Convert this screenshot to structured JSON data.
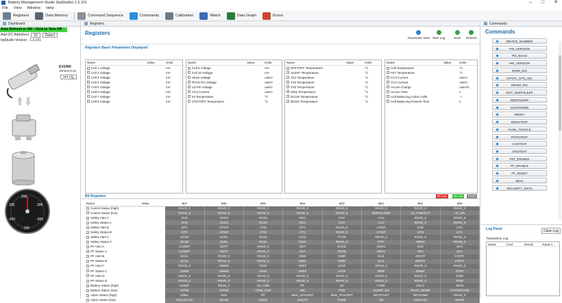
{
  "app": {
    "title": "Battery Management Studio (bqStudio) 1.3.101"
  },
  "window_controls": [
    "–",
    "□",
    "✕"
  ],
  "menu": [
    "File",
    "View",
    "Window",
    "Help"
  ],
  "toolbar": [
    {
      "label": "Registers",
      "icon": "gear-icon",
      "color": "#6b7f95"
    },
    {
      "label": "Data Memory",
      "icon": "car-icon",
      "color": "#5a6470"
    },
    {
      "label": "Command Sequence",
      "icon": "abc-icon",
      "color": "#8a9099"
    },
    {
      "label": "Commands",
      "icon": "refresh-arrows-icon",
      "color": "#2a8fd8"
    },
    {
      "label": "Calibration",
      "icon": "screen-icon",
      "color": "#6a7a8a"
    },
    {
      "label": "Watch",
      "icon": "watch-icon",
      "color": "#3a6ab8"
    },
    {
      "label": "Data Graph",
      "icon": "graph-icon",
      "color": "#2a7a3a"
    },
    {
      "label": "Errors",
      "icon": "errors-icon",
      "color": "#c74a2a"
    }
  ],
  "dashboard": {
    "title": "Dashboard",
    "auto_refresh": "Auto Refresh is ON - Click to Turn Off",
    "i2c_label": "Add I2C Addr(hex)",
    "i2c_value": "16",
    "detect_label": "Detect",
    "version_label": "bqStudio Version:",
    "version_value": "1.3.101",
    "device": "EV2400",
    "device_version": "Version:0.32",
    "spi_cfg": "SPI Cfg",
    "gauge_labels": [
      "200",
      "100",
      "300",
      "-200",
      "-300",
      "-100"
    ]
  },
  "registers": {
    "tab": "Registers",
    "title": "Registers",
    "subtitle": "Registers    Basic Parameters Displayed",
    "tools": [
      "Parameter View",
      "Start Log",
      "Scan",
      "Refresh"
    ],
    "columns": [
      "Name",
      "Value",
      "Units"
    ],
    "groups": [
      {
        "rows": [
          [
            "Cell 1 Voltage",
            "",
            "mV"
          ],
          [
            "Cell 2 Voltage",
            "",
            "mV"
          ],
          [
            "Cell 3 Voltage",
            "",
            "mV"
          ],
          [
            "Cell 4 Voltage",
            "",
            "mV"
          ],
          [
            "Cell 5 Voltage",
            "",
            "mV"
          ],
          [
            "Cell 6 Voltage",
            "",
            "mV"
          ],
          [
            "Cell 7 Voltage",
            "",
            "mV"
          ],
          [
            "Cell 8 Voltage",
            "",
            "mV"
          ]
        ]
      },
      {
        "rows": [
          [
            "Cell 9 Voltage",
            "",
            "mV"
          ],
          [
            "Cell 10 Voltage",
            "",
            "mV"
          ],
          [
            "Stack Voltage",
            "",
            "userV"
          ],
          [
            "PACK Pin Voltage",
            "",
            "userV"
          ],
          [
            "LD Pin Voltage",
            "",
            "userV"
          ],
          [
            "CC2 Current",
            "",
            "userA"
          ],
          [
            "Int Temperature",
            "",
            "°C"
          ],
          [
            "CFETOFF Temperature",
            "",
            "°C"
          ]
        ]
      },
      {
        "rows": [
          [
            "DFETOFF Temperature",
            "",
            "°C"
          ],
          [
            "ALERT Temperature",
            "",
            "°C"
          ],
          [
            "TS1 Temperature",
            "",
            "°C"
          ],
          [
            "TS2 Temperature",
            "",
            "°C"
          ],
          [
            "TS3 Temperature",
            "",
            "°C"
          ],
          [
            "HDQ Temperature",
            "",
            "°C"
          ],
          [
            "DCHG Temperature",
            "",
            "°C"
          ],
          [
            "DDSG Temperature",
            "",
            "°C"
          ]
        ]
      },
      {
        "rows": [
          [
            "Cell Temperature",
            "",
            "°C"
          ],
          [
            "FET Temperature",
            "",
            "°C"
          ],
          [
            "CC3 Current",
            "",
            "userA"
          ],
          [
            "CC1 Current",
            "",
            "userA"
          ],
          [
            "Accum Charge",
            "",
            "userAh"
          ],
          [
            "Accum Time",
            "",
            "s"
          ],
          [
            "Cell Balancing Active Cells",
            "",
            "—"
          ],
          [
            "Cell Balancing Present Time",
            "",
            "s"
          ]
        ]
      }
    ]
  },
  "bit_registers": {
    "title": "Bit Registers",
    "legend": [
      {
        "label": "Bit High",
        "color": "#e03030"
      },
      {
        "label": "Bit Low",
        "color": "#3fbf3f"
      },
      {
        "label": "RSVD",
        "color": "#888888"
      }
    ],
    "columns": [
      "Name",
      "Value",
      "Bit7",
      "Bit6",
      "Bit5",
      "Bit4",
      "Bit3",
      "Bit2",
      "Bit1",
      "Bit0"
    ],
    "rows": [
      {
        "name": "Control Status (high)",
        "bits": [
          "RSVD_0",
          "RSVD_0",
          "RSVD_0",
          "RSVD_0",
          "RSVD_0",
          "RSVD_0",
          "RSVD_0",
          "RSVD_0"
        ]
      },
      {
        "name": "Control Status (low)",
        "bits": [
          "RSVD_0",
          "RSVD_0",
          "RSVD_0",
          "RSVD_0",
          "RSVD_0",
          "DEEPSLEEP",
          "LD_TIMEOUT",
          "LD_ON"
        ]
      },
      {
        "name": "Safety Alert A",
        "bits": [
          "SCD",
          "OCD2",
          "OCD1",
          "OCC",
          "COV",
          "CUV",
          "RSVD_0",
          "RSVD_0"
        ]
      },
      {
        "name": "Safety Status A",
        "bits": [
          "SCD",
          "OCD2",
          "OCD1",
          "OCC",
          "COV",
          "CUV",
          "RSVD_0",
          "RSVD_0"
        ]
      },
      {
        "name": "Safety Alert B",
        "bits": [
          "OTF",
          "OTINT",
          "OTD",
          "OTC",
          "RSVD_0",
          "UTINT",
          "UTD",
          "UTC"
        ]
      },
      {
        "name": "Safety Status B",
        "bits": [
          "OTF",
          "OTINT",
          "OTD",
          "OTC",
          "RSVD_0",
          "UTINT",
          "UTD",
          "UTC"
        ]
      },
      {
        "name": "Safety Alert C",
        "bits": [
          "OCD3",
          "SCDL",
          "OCDL",
          "COVL",
          "PTOS",
          "RSVD_0",
          "RSVD_0",
          "RSVD_0"
        ]
      },
      {
        "name": "Safety Status C",
        "bits": [
          "OCD3",
          "SCDL",
          "OCDL",
          "COVL",
          "RSVD_0",
          "PTO",
          "HWDF",
          "RSVD_0"
        ]
      },
      {
        "name": "PF Alert A",
        "bits": [
          "CUDEP",
          "SOTF",
          "RSVD_0",
          "SOT",
          "SOCD",
          "SOCC",
          "SOV",
          "SUV"
        ]
      },
      {
        "name": "PF Status A",
        "bits": [
          "CUDEP",
          "SOTF",
          "RSVD_0",
          "SOT",
          "SOCD",
          "SOCC",
          "SOV",
          "SUV"
        ]
      },
      {
        "name": "PF Alert B",
        "bits": [
          "SCDL",
          "RSVD_0",
          "RSVD_0",
          "VIMA",
          "VIMR",
          "2LVL",
          "DFETF",
          "CFETF"
        ]
      },
      {
        "name": "PF Status B",
        "bits": [
          "SCDL",
          "RSVD_0",
          "RSVD_0",
          "VIMA",
          "VIMR",
          "2LVL",
          "DFETF",
          "CFETF"
        ]
      },
      {
        "name": "PF Alert C",
        "bits": [
          "RSVD_0",
          "HWMX",
          "VSSF",
          "VREF",
          "LFOF",
          "RSVD_0",
          "RSVD_0",
          "RSVD_0"
        ]
      },
      {
        "name": "PF Status C",
        "bits": [
          "CMDF",
          "HWMX",
          "VSSF",
          "VREF",
          "LFOF",
          "IRMF",
          "DRMF",
          "OTPF"
        ]
      },
      {
        "name": "PF Alert D",
        "bits": [
          "RSVD_0",
          "RSVD_0",
          "RSVD_0",
          "RSVD_0",
          "RSVD_0",
          "RSVD_0",
          "RSVD_0",
          "TOSF"
        ]
      },
      {
        "name": "PF Status D",
        "bits": [
          "RSVD_0",
          "RSVD_0",
          "RSVD_0",
          "RSVD_0",
          "RSVD_0",
          "RSVD_0",
          "RSVD_0",
          "TOSF"
        ]
      },
      {
        "name": "Battery Status (high)",
        "bits": [
          "SLEEP",
          "RSVD_0",
          "SD_CMD",
          "PF",
          "SS",
          "FUSE",
          "SEC1",
          "SEC0"
        ]
      },
      {
        "name": "Battery Status (low)",
        "bits": [
          "OTPB",
          "OTPW",
          "COW_CHK",
          "WD",
          "POR",
          "SLEEP_EN",
          "PCHG_MODE",
          "CFGUPDATE"
        ]
      },
      {
        "name": "Alarm Status (high)",
        "bits": [
          "SSBC",
          "SSA",
          "PF",
          "MSK_SFALERT",
          "MSK_PFALERT",
          "INITSTART",
          "INITCOMP",
          "RSVD_0"
        ]
      },
      {
        "name": "Alarm Status (low)",
        "bits": [
          "FULLSCAN",
          "XCHG",
          "XDSG",
          "SHUTV",
          "FUSE",
          "CB",
          "ADSCAN",
          "WAKE"
        ]
      }
    ]
  },
  "commands": {
    "tab": "Commands",
    "title": "Commands",
    "items": [
      "DEVICE_NUMBER",
      "FW_VERSION",
      "FW_BUILD",
      "HW_VERSION",
      "IROM_SIG",
      "STATIC_CFG_SIG",
      "DROM_SIG",
      "EXIT_DEEPSLEEP",
      "DEEPSLEEP",
      "SHUTDOWN",
      "RESET",
      "RDSGTEST",
      "FUSE_TOGGLE",
      "PCHGTEST",
      "CHGTEST",
      "DSGTEST",
      "FET_ENABLE",
      "PF_ENABLE",
      "PF_RESET",
      "SEAL",
      "SECURITY_KEYS"
    ]
  },
  "log": {
    "title": "Log Panel",
    "clear": "Clear Log",
    "subtitle": "Transaction Log",
    "columns": [
      "Name",
      "Cmd",
      "Result",
      "Read A..."
    ]
  }
}
